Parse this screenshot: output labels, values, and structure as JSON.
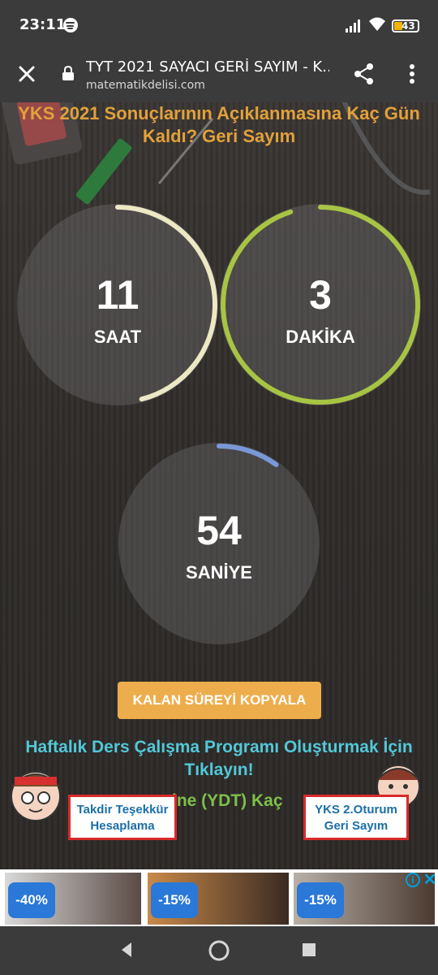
{
  "status_bar": {
    "time": "23:11",
    "battery": "43",
    "icons": [
      "spotify-icon",
      "signal-icon",
      "wifi-icon",
      "battery-icon"
    ]
  },
  "browser": {
    "title": "TYT 2021 SAYACI GERİ SAYIM - K...",
    "url": "matematikdelisi.com",
    "icons": [
      "close-icon",
      "lock-icon",
      "share-icon",
      "more-vert-icon"
    ]
  },
  "page": {
    "headline": "YKS 2021 Sonuçlarının Açıklanmasına Kaç Gün Kaldı? Geri Sayım",
    "counters": [
      {
        "value": "11",
        "label": "SAAT",
        "progress": 0.46,
        "color": "#ece8c4"
      },
      {
        "value": "3",
        "label": "DAKİKA",
        "progress": 0.95,
        "color": "#a8c443"
      },
      {
        "value": "54",
        "label": "SANİYE",
        "progress": 0.1,
        "color": "#7a98d8"
      }
    ],
    "copy_button": "KALAN SÜREYİ KOPYALA",
    "program_link": "Haftalık Ders Çalışma Programı Oluşturmak İçin Tıklayın!",
    "partial_text": "ine (YDT) Kaç",
    "float_left": {
      "line1": "Takdir Teşekkür",
      "line2": "Hesaplama"
    },
    "float_right": {
      "line1": "YKS 2.Oturum",
      "line2": "Geri Sayım"
    }
  },
  "ads": [
    {
      "badge": "-40%"
    },
    {
      "badge": "-15%"
    },
    {
      "badge": "-15%"
    }
  ],
  "colors": {
    "headline": "#e2a13a",
    "copy_button": "#eead4c",
    "link": "#52c8d8",
    "accent_red": "#d82a2a"
  }
}
